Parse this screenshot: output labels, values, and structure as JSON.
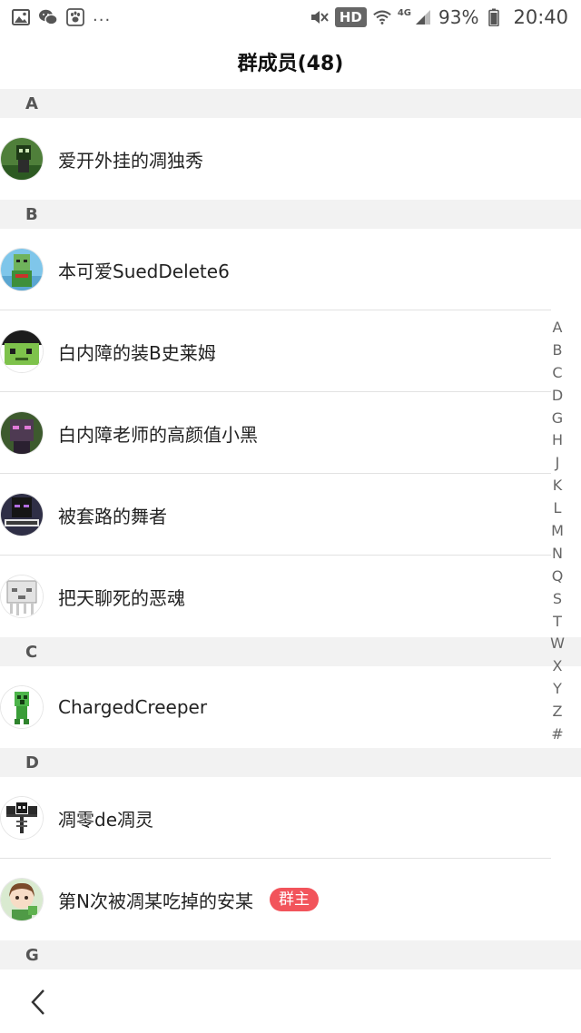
{
  "status_bar": {
    "more_indicator": "...",
    "hd_label": "HD",
    "network_label": "4G",
    "battery_percent": "93%",
    "time": "20:40",
    "battery_level": 0.93
  },
  "header": {
    "title": "群成员(48)"
  },
  "sections": [
    {
      "letter": "A",
      "members": [
        {
          "name": "爱开外挂的凋独秀",
          "avatar": "creeper-green-avatar"
        }
      ]
    },
    {
      "letter": "B",
      "members": [
        {
          "name": "本可爱SuedDelete6",
          "avatar": "blue-blocky-avatar"
        },
        {
          "name": "白内障的装B史莱姆",
          "avatar": "green-face-avatar"
        },
        {
          "name": "白内障老师的高颜值小黑",
          "avatar": "enderman-pink-avatar"
        },
        {
          "name": "被套路的舞者",
          "avatar": "dark-ender-avatar"
        },
        {
          "name": "把天聊死的恶魂",
          "avatar": "ghast-white-avatar"
        }
      ]
    },
    {
      "letter": "C",
      "members": [
        {
          "name": "ChargedCreeper",
          "avatar": "charged-creeper-avatar"
        }
      ]
    },
    {
      "letter": "D",
      "members": [
        {
          "name": "凋零de凋灵",
          "avatar": "wither-skeleton-avatar"
        },
        {
          "name": "第N次被凋某吃掉的安某",
          "avatar": "anime-girl-avatar",
          "badge": "群主"
        }
      ]
    },
    {
      "letter": "G",
      "members": []
    }
  ],
  "alpha_index": [
    "A",
    "B",
    "C",
    "D",
    "G",
    "H",
    "J",
    "K",
    "L",
    "M",
    "N",
    "Q",
    "S",
    "T",
    "W",
    "X",
    "Y",
    "Z",
    "#"
  ],
  "colors": {
    "owner_badge": "#f2545b",
    "section_background": "#f2f2f2",
    "divider": "#e2e2e2"
  }
}
